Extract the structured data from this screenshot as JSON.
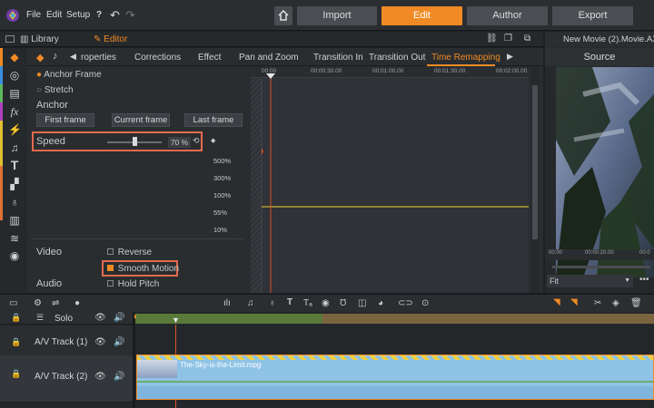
{
  "menu": {
    "file": "File",
    "edit": "Edit",
    "setup": "Setup"
  },
  "main_tabs": {
    "import": "Import",
    "edit": "Edit",
    "author": "Author",
    "export": "Export"
  },
  "subbar": {
    "library": "Library",
    "editor": "Editor"
  },
  "panel_tabs": [
    "roperties",
    "Corrections",
    "Effect",
    "Pan and Zoom",
    "Transition In",
    "Transition Out",
    "Time Remapping"
  ],
  "options": {
    "anchor_frame": "Anchor Frame",
    "stretch": "Stretch",
    "anchor": "Anchor",
    "first_frame": "First frame",
    "current_frame": "Current frame",
    "last_frame": "Last frame",
    "speed_label": "Speed",
    "speed_value": "70 %",
    "speed_fraction": 0.5,
    "video_label": "Video",
    "reverse": "Reverse",
    "smooth_motion": "Smooth Motion",
    "audio_label": "Audio",
    "hold_pitch": "Hold Pitch"
  },
  "graph": {
    "ruler": [
      "00:00",
      "00:00:30.00",
      "00:01:00.00",
      "00:01:30.00",
      "00:02:00.00"
    ],
    "percentages": [
      "500%",
      "300%",
      "100%",
      "55%",
      "10%"
    ]
  },
  "source": {
    "title": "New Movie (2).Movie.AXP",
    "label": "Source",
    "ruler": [
      "00:00",
      "00:00:20.00",
      "00:0"
    ],
    "fit": "Fit"
  },
  "timeline": {
    "solo": "Solo",
    "tracks": [
      "A/V Track (1)",
      "A/V Track (2)"
    ],
    "clip_name": "The-Sky-is-the-Limit.mpg"
  },
  "colors": {
    "accent": "#f08a24",
    "highlight": "#e46a4e",
    "clip": "#8fc3e6",
    "graph_line": "#c9b431"
  }
}
